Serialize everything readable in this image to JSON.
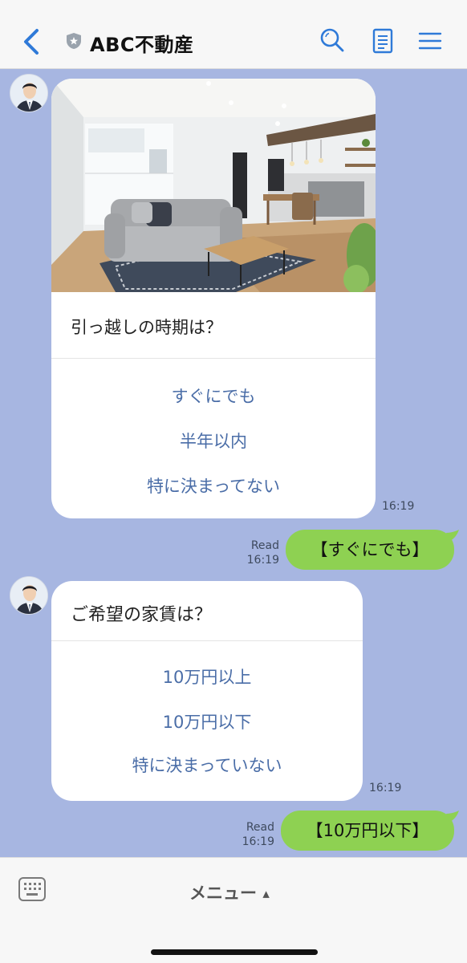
{
  "header": {
    "title": "ABC不動産"
  },
  "messages": [
    {
      "sender": "bot",
      "question": "引っ越しの時期は？",
      "options": [
        "すぐにでも",
        "半年以内",
        "特に決まってない"
      ],
      "time": "16:19"
    },
    {
      "sender": "me",
      "text": "【すぐにでも】",
      "read_label": "Read",
      "time": "16:19"
    },
    {
      "sender": "bot",
      "question": "ご希望の家賃は？",
      "options": [
        "10万円以上",
        "10万円以下",
        "特に決まっていない"
      ],
      "time": "16:19"
    },
    {
      "sender": "me",
      "text": "【10万円以下】",
      "read_label": "Read",
      "time": "16:19"
    }
  ],
  "bottom_bar": {
    "menu_label": "メニュー",
    "menu_arrow": "▲"
  },
  "colors": {
    "background": "#a7b6e1",
    "accent_blue": "#2f7ad8",
    "my_bubble": "#8ed152",
    "option_text": "#4a6da7"
  },
  "icons": {
    "back": "chevron-left-icon",
    "shield": "shield-star-icon",
    "search": "search-icon",
    "notes": "notes-icon",
    "menu": "hamburger-menu-icon",
    "keyboard": "keyboard-icon"
  }
}
